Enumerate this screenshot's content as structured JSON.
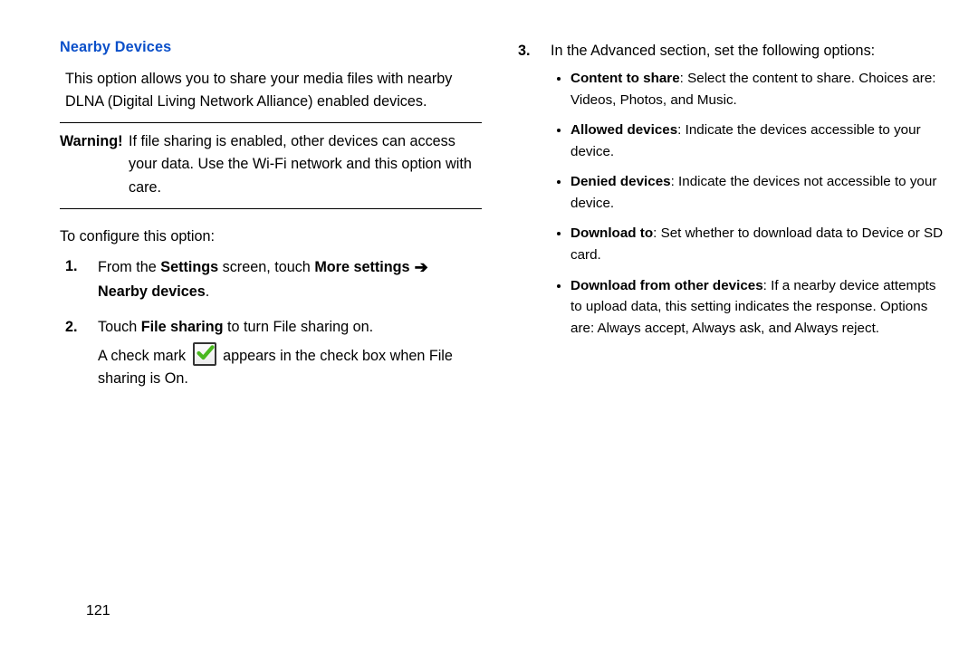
{
  "left": {
    "heading": "Nearby Devices",
    "intro": "This option allows you to share your media files with nearby DLNA (Digital Living Network Alliance) enabled devices.",
    "warning_label": "Warning!",
    "warning_body_line1": "If file sharing is enabled, other devices can access",
    "warning_body_rest": "your data. Use the Wi-Fi network and this option with care.",
    "configure": "To configure this option:",
    "step1_pre": "From the ",
    "step1_settings": "Settings",
    "step1_mid": " screen, touch ",
    "step1_more": "More settings",
    "step1_arrow": " ➔ ",
    "step1_nearby": "Nearby devices",
    "step1_end": ".",
    "step2_pre": "Touch ",
    "step2_fs": "File sharing",
    "step2_post": " to turn File sharing on.",
    "step2b_pre": "A check mark ",
    "step2b_post": " appears in the check box when File sharing is On."
  },
  "right": {
    "step3_intro": "In the Advanced section, set the following options:",
    "b1_label": "Content to share",
    "b1_text": ": Select the content to share. Choices are: Videos, Photos, and Music.",
    "b2_label": "Allowed devices",
    "b2_text": ": Indicate the devices accessible to your device.",
    "b3_label": "Denied devices",
    "b3_text": ": Indicate the devices not accessible to your device.",
    "b4_label": "Download to",
    "b4_text": ": Set whether to download data to Device or SD card.",
    "b5_label": "Download from other devices",
    "b5_text": ": If a nearby device attempts to upload data, this setting indicates the response. Options are: Always accept, Always ask, and Always reject."
  },
  "page_number": "121"
}
